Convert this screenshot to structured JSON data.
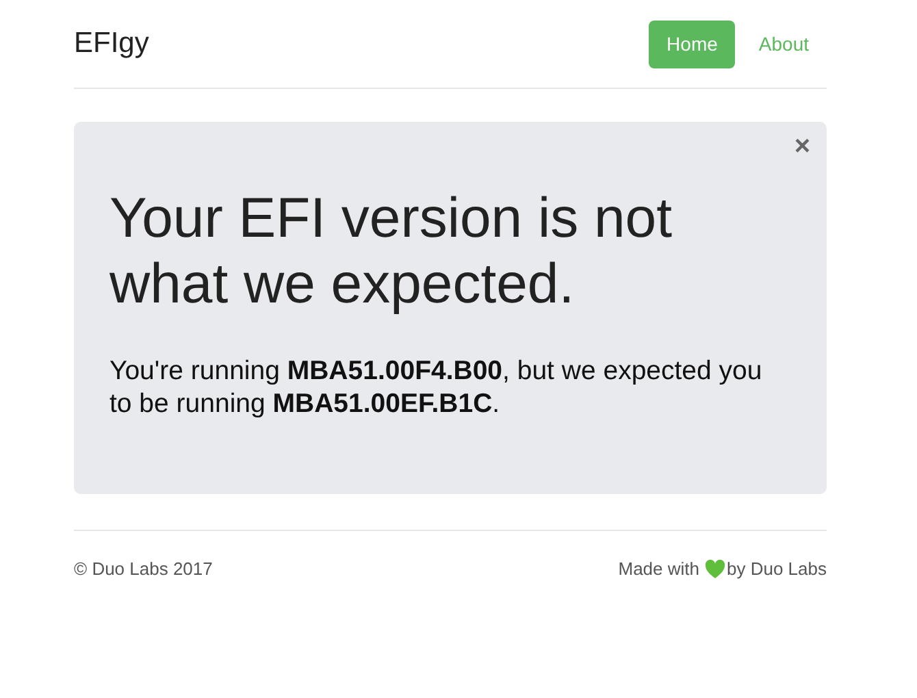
{
  "header": {
    "brand": "EFIgy",
    "nav": [
      {
        "label": "Home",
        "selected": true
      },
      {
        "label": "About",
        "selected": false
      }
    ]
  },
  "alert": {
    "close": "×",
    "heading": "Your EFI version is not what we expected.",
    "message": "You're running **MBA51.00F4.B00**, but we expected you to be running **MBA51.00EF.B1C**."
  },
  "footer": {
    "copyright": "© Duo Labs 2017",
    "made_with": "Made with",
    "by": "by Duo Labs"
  }
}
